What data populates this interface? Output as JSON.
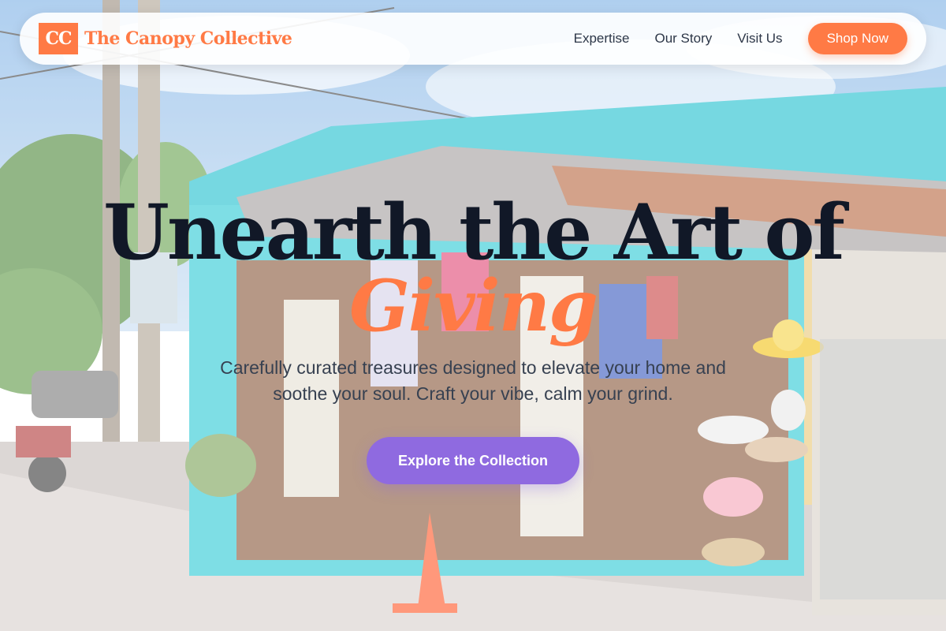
{
  "brand": {
    "logo_mark": "CC",
    "name": "The Canopy Collective"
  },
  "nav": {
    "links": [
      {
        "label": "Expertise"
      },
      {
        "label": "Our Story"
      },
      {
        "label": "Visit Us"
      }
    ],
    "cta_label": "Shop Now"
  },
  "hero": {
    "headline": "Unearth the Art of",
    "headline_accent": "Giving",
    "subcopy": "Carefully curated treasures designed to elevate your home and soothe your soul. Craft your vibe, calm your grind.",
    "cta_label": "Explore the Collection"
  },
  "colors": {
    "accent": "#ff7a45",
    "cta": "#8f6ae0",
    "headline": "#111827",
    "body_text": "#374151"
  },
  "background": {
    "subject": "turquoise street-side craft shop with hats and textiles"
  }
}
